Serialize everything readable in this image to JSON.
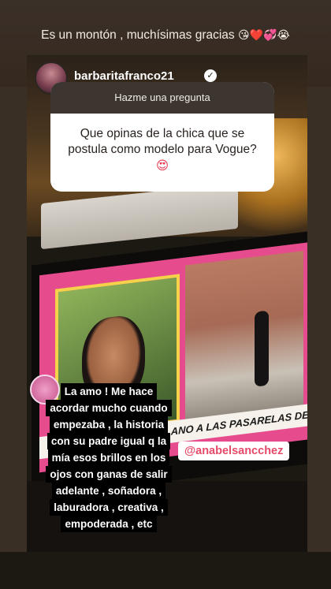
{
  "caption": {
    "text": "Es un montón , muchísimas gracias",
    "emojis": "😘❤️💞😭"
  },
  "header": {
    "username": "barbaritafranco21",
    "verified_icon": "verified-badge-icon"
  },
  "question_sticker": {
    "title": "Hazme una pregunta",
    "question": "Que opinas de la chica que se postula como modelo para Vogue?",
    "emoji": "😍"
  },
  "tv": {
    "ticker": "NCHEZ DE SOLANO A LAS PASARELAS DEL MUND"
  },
  "reply_lines": [
    "La amo !  Me hace",
    "acordar mucho cuando",
    "empezaba , la historia",
    "con su padre igual q la",
    "mía esos brillos en los",
    "ojos con ganas de salir",
    "adelante , soñadora ,",
    "laburadora , creativa ,",
    "empoderada , etc"
  ],
  "mention": "@anabelsancchez"
}
